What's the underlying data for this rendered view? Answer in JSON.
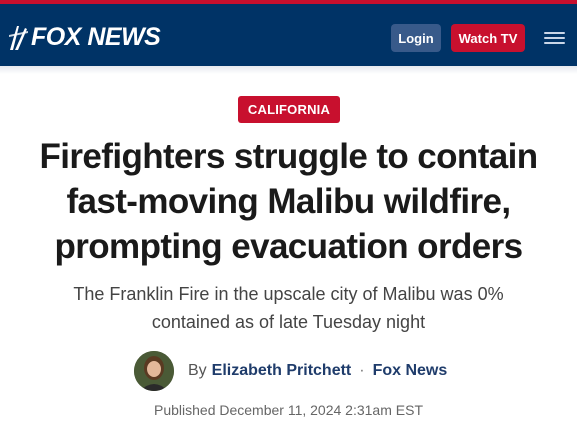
{
  "header": {
    "logo_text": "FOX NEWS",
    "login_label": "Login",
    "watch_label": "Watch TV",
    "colors": {
      "navy": "#003366",
      "red": "#c8102e"
    }
  },
  "article": {
    "category": "CALIFORNIA",
    "headline": "Firefighters struggle to contain fast-moving Malibu wildfire, prompting evacuation orders",
    "subheadline": "The Franklin Fire in the upscale city of Malibu was 0% contained as of late Tuesday night",
    "byline": {
      "prefix": "By",
      "author": "Elizabeth Pritchett",
      "separator": "·",
      "source": "Fox News"
    },
    "published": "Published December 11, 2024 2:31am EST"
  }
}
